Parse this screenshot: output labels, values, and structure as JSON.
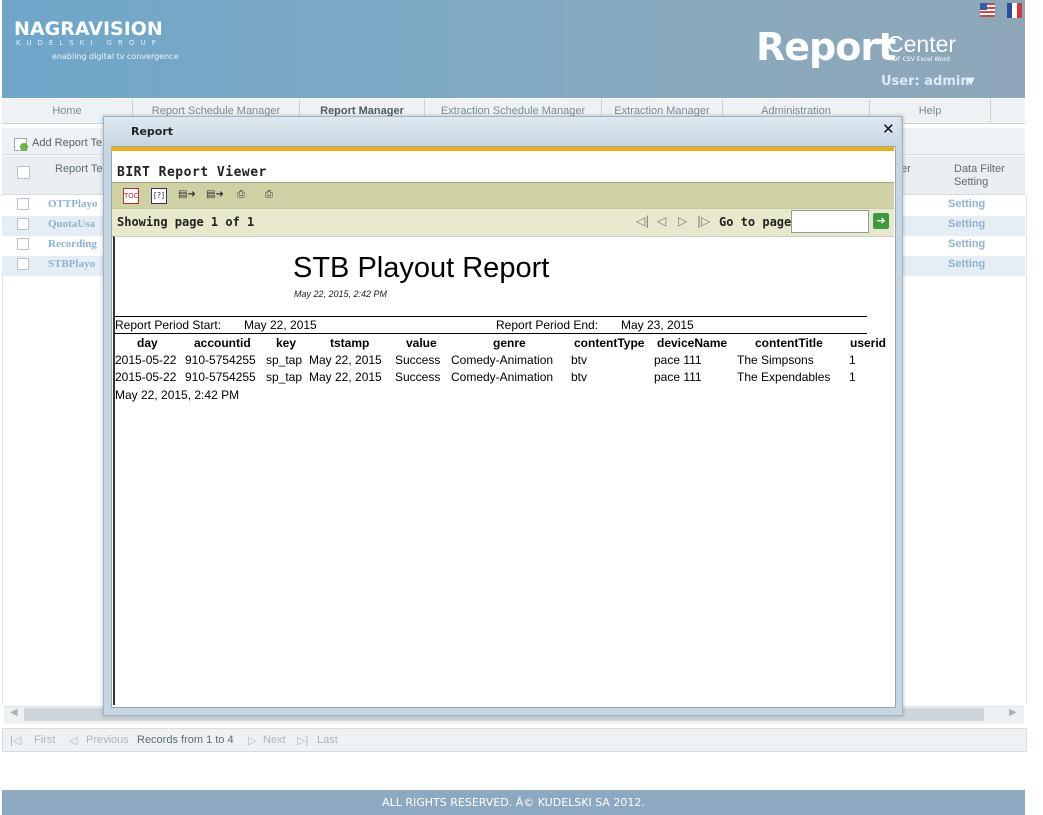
{
  "header": {
    "logo": "NAGRAVISION",
    "logo_group": "KUDELSKI GROUP",
    "logo_tagline": "enabling digital tv convergence",
    "product_report": "Report",
    "product_center": "Center",
    "product_formats": "PDF CSV Excel Word",
    "user_label": "User: admin",
    "flags": [
      "us-flag-icon",
      "fr-flag-icon"
    ]
  },
  "nav": {
    "items": [
      "Home",
      "Report Schedule Manager",
      "Report Manager",
      "Extraction Schedule Manager",
      "Extraction Manager",
      "Administration",
      "Help"
    ],
    "active": "Report Manager"
  },
  "toolbar": {
    "add_label": "Add Report Te"
  },
  "grid": {
    "headers": {
      "template": "Report Te",
      "filter_right": "er",
      "data_filter": "Data Filter Setting"
    },
    "rows": [
      {
        "name": "OTTPlayo",
        "setting": "Setting"
      },
      {
        "name": "QuotaUsa",
        "setting": "Setting"
      },
      {
        "name": "Recording",
        "setting": "Setting"
      },
      {
        "name": "STBPlayo",
        "setting": "Setting"
      }
    ]
  },
  "pager": {
    "first": "First",
    "previous": "Previous",
    "records": "Records from 1 to 4",
    "next": "Next",
    "last": "Last"
  },
  "footer": {
    "text": "ALL RIGHTS RESERVED. Â© KUDELSKI SA 2012."
  },
  "modal": {
    "title": "Report",
    "close": "✕",
    "viewer_heading": "BIRT Report Viewer",
    "showing_page": "Showing page  1  of  1",
    "goto_label": "Go to page:",
    "goto_value": "",
    "report": {
      "title": "STB Playout Report",
      "generated": "May 22, 2015, 2:42 PM",
      "period_start_label": "Report Period Start:",
      "period_start": "May 22, 2015",
      "period_end_label": "Report Period End:",
      "period_end": "May 23, 2015",
      "columns": [
        "day",
        "accountid",
        "key",
        "tstamp",
        "value",
        "genre",
        "contentType",
        "deviceName",
        "contentTitle",
        "userid"
      ],
      "rows": [
        [
          "2015-05-22",
          "910-5754255",
          "sp_tap",
          "May 22, 2015",
          "Success",
          "Comedy-Animation",
          "btv",
          "pace 111",
          "The Simpsons",
          "1"
        ],
        [
          "2015-05-22",
          "910-5754255",
          "sp_tap",
          "May 22, 2015",
          "Success",
          "Comedy-Animation",
          "btv",
          "pace 111",
          "The Expendables",
          "1"
        ]
      ],
      "footer_date": "May 22, 2015, 2:42 PM"
    }
  },
  "colors": {
    "header": "#7fa9c4",
    "footer": "#8da9c2",
    "viewer_accent": "#e6b212",
    "viewer_toolbar": "#cfd1a4"
  }
}
